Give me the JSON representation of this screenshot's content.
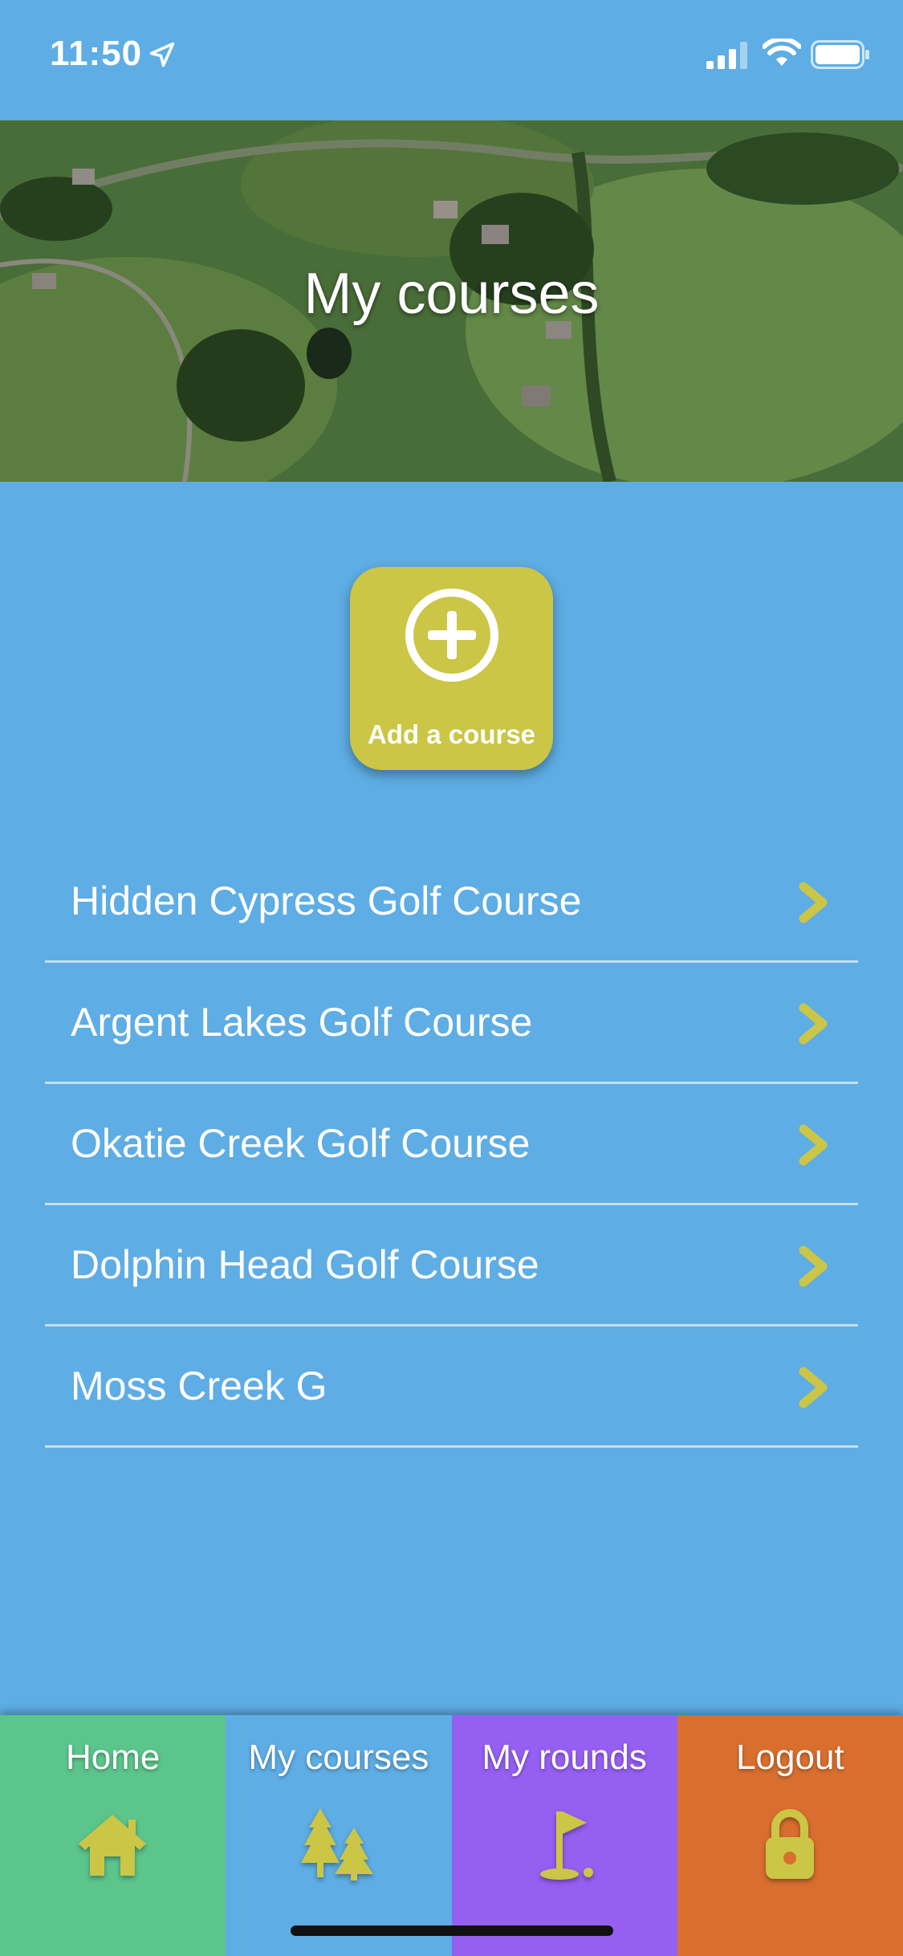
{
  "status_bar": {
    "time": "11:50"
  },
  "hero": {
    "title": "My courses"
  },
  "add_course": {
    "label": "Add a course"
  },
  "courses": [
    {
      "name": "Hidden Cypress Golf Course"
    },
    {
      "name": "Argent Lakes Golf Course"
    },
    {
      "name": "Okatie Creek Golf Course"
    },
    {
      "name": "Dolphin Head Golf Course"
    },
    {
      "name": "Moss Creek G"
    }
  ],
  "tabbar": {
    "home": {
      "label": "Home",
      "icon": "house-icon",
      "color": "#5bc58b"
    },
    "courses": {
      "label": "My courses",
      "icon": "trees-icon",
      "color": "#5eade4"
    },
    "rounds": {
      "label": "My rounds",
      "icon": "golf-flag-icon",
      "color": "#955ff2"
    },
    "logout": {
      "label": "Logout",
      "icon": "lock-icon",
      "color": "#d96f2f"
    }
  },
  "colors": {
    "background": "#5eade4",
    "accent": "#cbc646",
    "divider": "#c5dff1"
  }
}
